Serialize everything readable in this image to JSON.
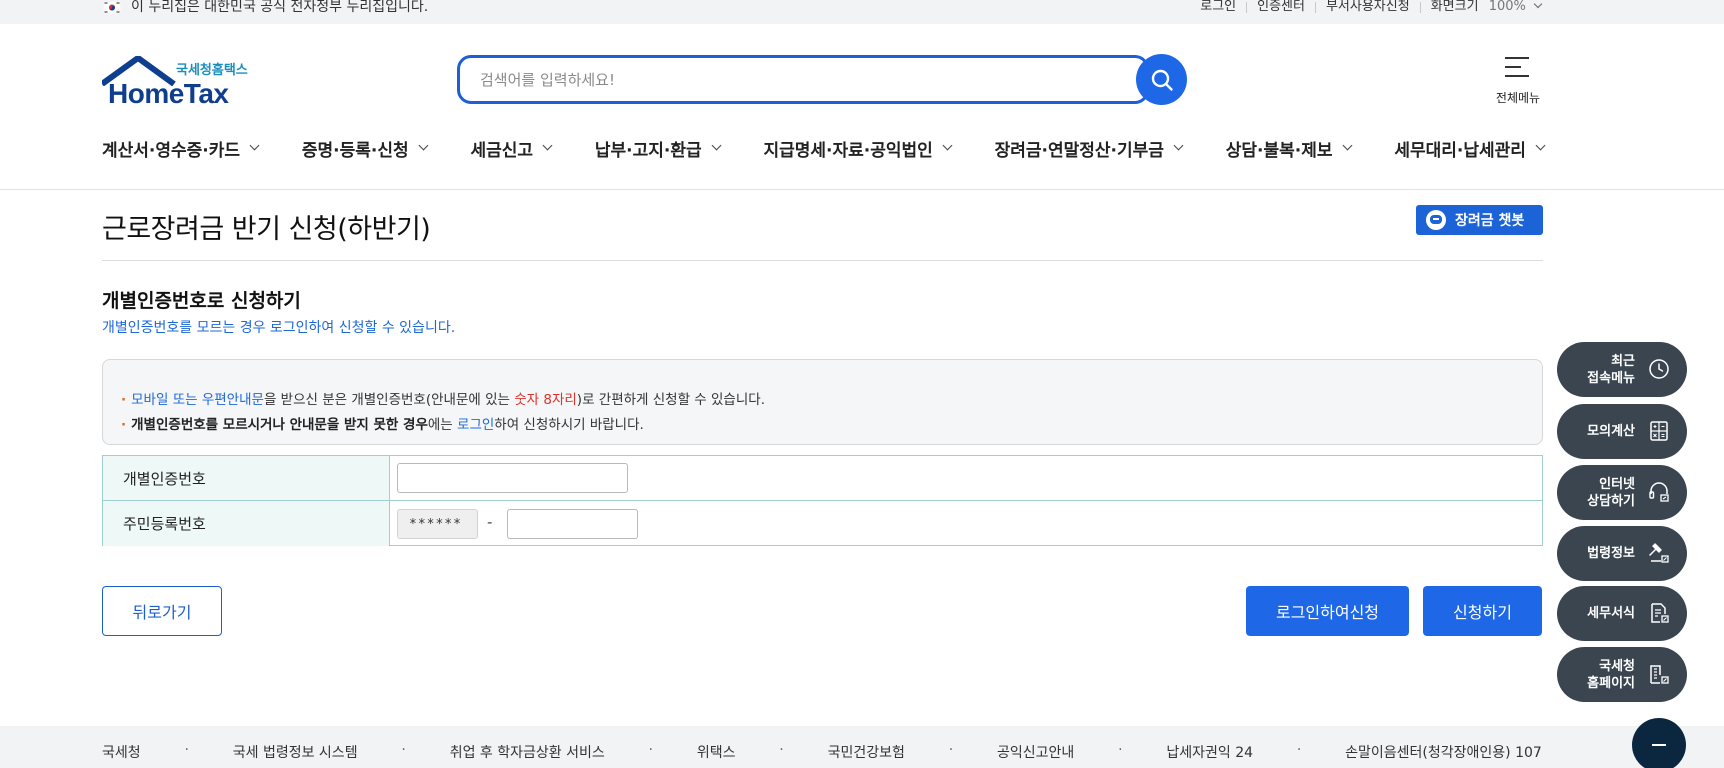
{
  "gov_bar": {
    "text": "이 누리집은 대한민국 공식 전자정부 누리집입니다.",
    "links": [
      "로그인",
      "인증센터",
      "부서사용자신청",
      "화면크기"
    ],
    "zoom": "100%"
  },
  "header": {
    "logo_small": "국세청홈택스",
    "logo_brand": "HomeTax",
    "search_placeholder": "검색어를 입력하세요!",
    "all_menu_label": "전체메뉴"
  },
  "gnb": [
    "계산서·영수증·카드",
    "증명·등록·신청",
    "세금신고",
    "납부·고지·환급",
    "지급명세·자료·공익법인",
    "장려금·연말정산·기부금",
    "상담·불복·제보",
    "세무대리·납세관리"
  ],
  "page": {
    "title": "근로장려금 반기 신청(하반기)",
    "chatbot_label": "장려금 챗봇",
    "sub_title": "개별인증번호로 신청하기",
    "sub_desc": "개별인증번호를 모르는 경우 로그인하여 신청할 수 있습니다."
  },
  "notice": {
    "line1": {
      "part1": "모바일 또는 우편안내문",
      "part2": "을 받으신 분은 개별인증번호(안내문에 있는 ",
      "part3": "숫자 8자리",
      "part4": ")로 간편하게 신청할 수 있습니다."
    },
    "line2": {
      "part1": "개별인증번호를 모르시거나 안내문을 받지 못한 경우",
      "part2": "에는 ",
      "part3": "로그인",
      "part4": "하여 신청하시기 바랍니다."
    }
  },
  "form": {
    "auth_label": "개별인증번호",
    "auth_value": "",
    "rrn_label": "주민등록번호",
    "rrn_front": "******",
    "rrn_dash": "-",
    "rrn_back_value": ""
  },
  "buttons": {
    "back": "뒤로가기",
    "login_apply": "로그인하여신청",
    "apply": "신청하기"
  },
  "quick_menu": [
    {
      "label_1": "최근",
      "label_2": "접속메뉴",
      "icon": "clock-icon"
    },
    {
      "label_1": "모의계산",
      "label_2": "",
      "icon": "calculator-icon"
    },
    {
      "label_1": "인터넷",
      "label_2": "상담하기",
      "icon": "headset-icon"
    },
    {
      "label_1": "법령정보",
      "label_2": "",
      "icon": "gavel-icon"
    },
    {
      "label_1": "세무서식",
      "label_2": "",
      "icon": "document-icon"
    },
    {
      "label_1": "국세청",
      "label_2": "홈페이지",
      "icon": "building-icon"
    }
  ],
  "footer": [
    "국세청",
    "국세 법령정보 시스템",
    "취업 후 학자금상환 서비스",
    "위택스",
    "국민건강보험",
    "공익신고안내",
    "납세자권익 24",
    "손말이음센터(청각장애인용) 107"
  ],
  "colors": {
    "primary": "#1e68e8",
    "accent_text": "#1e68d8",
    "highlight_red": "#e0322a",
    "quick_menu_bg": "#3a4550",
    "table_border": "#9fcfd0",
    "table_header_bg": "#eef8f6"
  }
}
